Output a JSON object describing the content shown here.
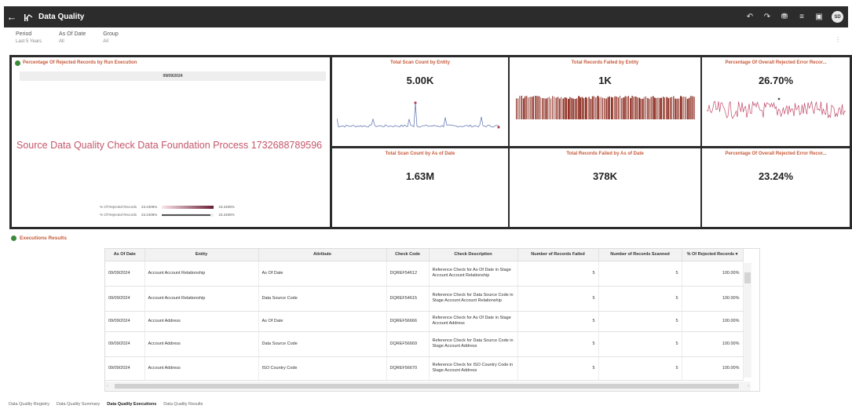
{
  "topbar": {
    "back_icon": "back-arrow-icon",
    "title": "Data Quality",
    "avatar_initials": "SD",
    "icons": [
      "undo-icon",
      "redo-icon",
      "filter-icon",
      "list-icon",
      "present-icon"
    ]
  },
  "filters": [
    {
      "label": "Period",
      "value": "Last 5 Years"
    },
    {
      "label": "As Of Date",
      "value": "All"
    },
    {
      "label": "Group",
      "value": "All"
    }
  ],
  "left_tile": {
    "title": "Percentage Of Rejected Records by Run Execution",
    "date": "09/09/2024",
    "big_text": "Source Data Quality Check Data Foundation Process 1732688789596",
    "legend": [
      {
        "label": "% Of Rejected Records",
        "min": "23.2406%",
        "max": "23.2406%"
      },
      {
        "label": "% Of Rejected Records",
        "min": "23.2406%",
        "max": "23.2406%"
      }
    ]
  },
  "tiles": [
    {
      "title": "Total Scan Count by Entity",
      "value": "5.00K"
    },
    {
      "title": "Total Records Failed by Entity",
      "value": "1K"
    },
    {
      "title": "Percentage Of Overall Rejected Error Recor...",
      "value": "26.70%"
    },
    {
      "title": "Total Scan Count by As of Date",
      "value": "1.63M"
    },
    {
      "title": "Total Records Failed by As of Date",
      "value": "378K"
    },
    {
      "title": "Percentage Of Overall Rejected Error Recor...",
      "value": "23.24%"
    }
  ],
  "executions": {
    "title": "Executions Results",
    "columns": [
      "As Of Date",
      "Entity",
      "Attribute",
      "Check Code",
      "Check Description",
      "Number of Records Failed",
      "Number of Records Scanned",
      "% Of Rejected Records ▾"
    ],
    "rows": [
      [
        "09/09/2024",
        "Account Account Relationship",
        "As Of Date",
        "DQREF54612",
        "Reference Check for As Of Date in Stage Account Account Relationship",
        "5",
        "5",
        "100.00%"
      ],
      [
        "09/09/2024",
        "Account Account Relationship",
        "Data Source Code",
        "DQREF54615",
        "Reference Check for Data Source Code in Stage Account Account Relationship",
        "5",
        "5",
        "100.00%"
      ],
      [
        "09/09/2024",
        "Account Address",
        "As Of Date",
        "DQREF56666",
        "Reference Check for As Of Date in Stage Account Address",
        "5",
        "5",
        "100.00%"
      ],
      [
        "09/09/2024",
        "Account Address",
        "Data Source Code",
        "DQREF56669",
        "Reference Check for Data Source Code in Stage Account Address",
        "5",
        "5",
        "100.00%"
      ],
      [
        "09/09/2024",
        "Account Address",
        "ISO Country Code",
        "DQREF56670",
        "Reference Check for ISO Country Code in Stage Account Address",
        "5",
        "5",
        "100.00%"
      ]
    ]
  },
  "footer_tabs": [
    {
      "label": "Data Quality Registry",
      "active": false
    },
    {
      "label": "Data Quality Summary",
      "active": false
    },
    {
      "label": "Data Quality Executions",
      "active": true
    },
    {
      "label": "Data Quality Results",
      "active": false
    }
  ],
  "colors": {
    "accent_title": "#c65a3a",
    "bars": "#8c2b1f",
    "line_scan": "#6b7fb8",
    "line_pct": "#c24a6a",
    "big_text": "#c4566a"
  }
}
